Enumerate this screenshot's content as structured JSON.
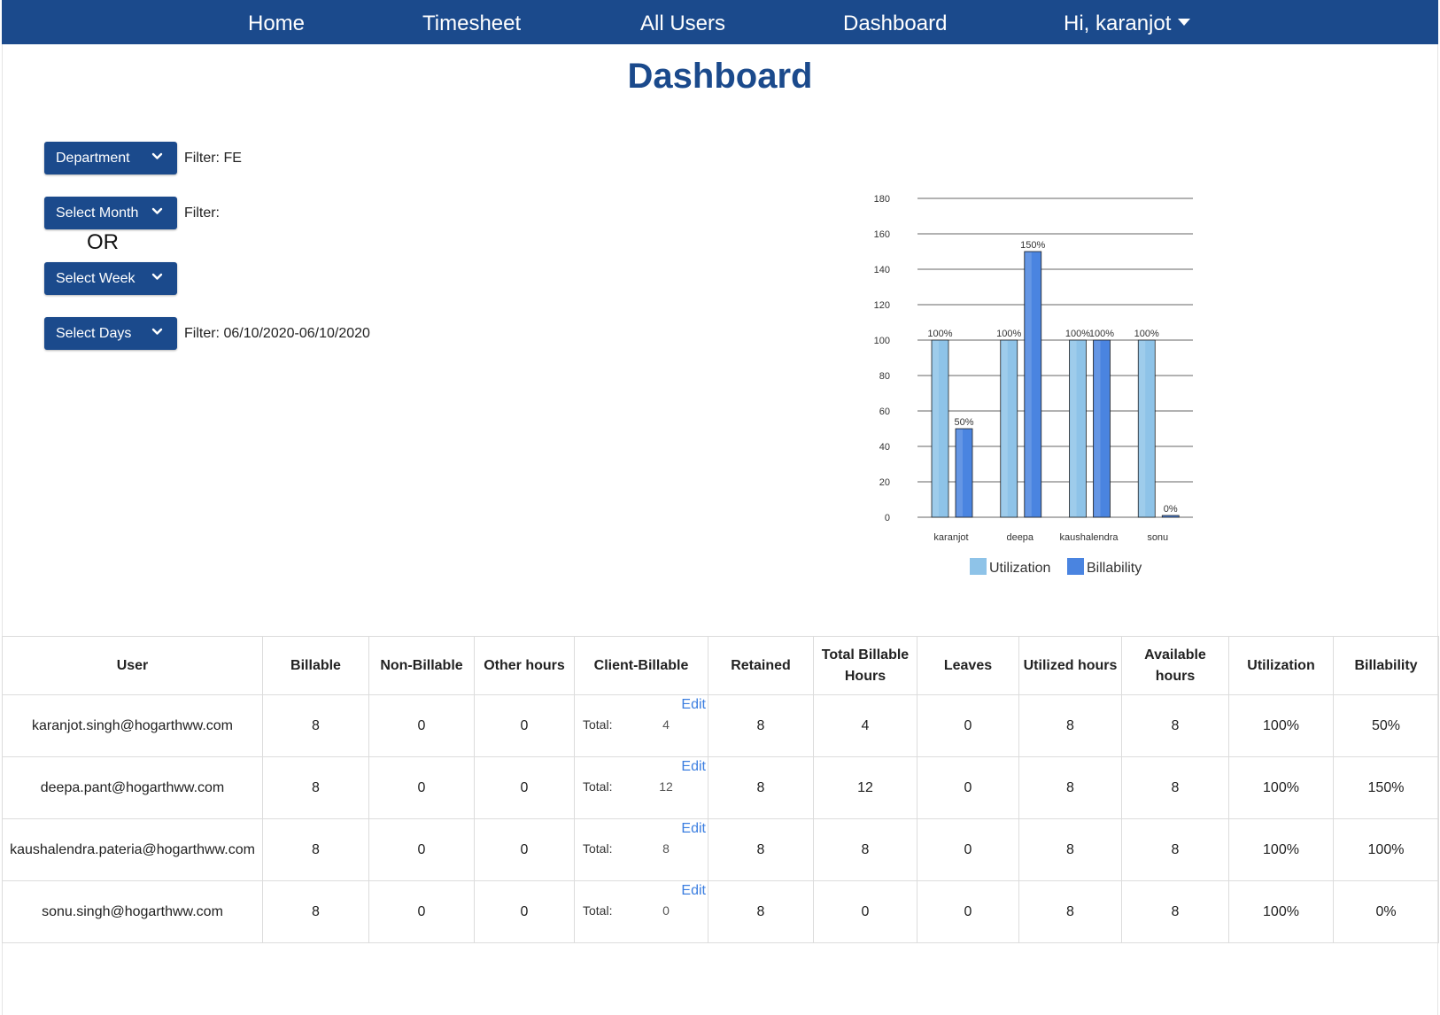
{
  "nav": {
    "home": "Home",
    "timesheet": "Timesheet",
    "all_users": "All Users",
    "dashboard": "Dashboard",
    "greeting": "Hi, karanjot"
  },
  "page": {
    "title": "Dashboard"
  },
  "filters": {
    "department_label": "Department",
    "department_filter": "Filter: FE",
    "month_label": "Select Month",
    "month_filter": "Filter:",
    "or_text": "OR",
    "week_label": "Select Week",
    "days_label": "Select Days",
    "days_filter": "Filter: 06/10/2020-06/10/2020"
  },
  "chart_data": {
    "type": "bar",
    "categories": [
      "karanjot",
      "deepa",
      "kaushalendra",
      "sonu"
    ],
    "series": [
      {
        "name": "Utilization",
        "values": [
          100,
          100,
          100,
          100
        ],
        "labels": [
          "100%",
          "100%",
          "100%",
          "100%"
        ],
        "color": "#8ec3e8"
      },
      {
        "name": "Billability",
        "values": [
          50,
          150,
          100,
          0
        ],
        "labels": [
          "50%",
          "150%",
          "100%",
          "0%"
        ],
        "color": "#4a84e0"
      }
    ],
    "ylim": [
      0,
      180
    ],
    "yticks": [
      0,
      20,
      40,
      60,
      80,
      100,
      120,
      140,
      160,
      180
    ],
    "grid": true,
    "legend": "bottom"
  },
  "table": {
    "headers": [
      "User",
      "Billable",
      "Non-Billable",
      "Other hours",
      "Client-Billable",
      "Retained",
      "Total Billable Hours",
      "Leaves",
      "Utilized hours",
      "Available hours",
      "Utilization",
      "Billability"
    ],
    "edit_label": "Edit",
    "total_label": "Total:",
    "rows": [
      {
        "user": "karanjot.singh@hogarthww.com",
        "billable": "8",
        "non_billable": "0",
        "other_hours": "0",
        "client_total": "4",
        "retained": "8",
        "total_billable": "4",
        "leaves": "0",
        "utilized": "8",
        "available": "8",
        "utilization": "100%",
        "billability": "50%"
      },
      {
        "user": "deepa.pant@hogarthww.com",
        "billable": "8",
        "non_billable": "0",
        "other_hours": "0",
        "client_total": "12",
        "retained": "8",
        "total_billable": "12",
        "leaves": "0",
        "utilized": "8",
        "available": "8",
        "utilization": "100%",
        "billability": "150%"
      },
      {
        "user": "kaushalendra.pateria@hogarthww.com",
        "billable": "8",
        "non_billable": "0",
        "other_hours": "0",
        "client_total": "8",
        "retained": "8",
        "total_billable": "8",
        "leaves": "0",
        "utilized": "8",
        "available": "8",
        "utilization": "100%",
        "billability": "100%"
      },
      {
        "user": "sonu.singh@hogarthww.com",
        "billable": "8",
        "non_billable": "0",
        "other_hours": "0",
        "client_total": "0",
        "retained": "8",
        "total_billable": "0",
        "leaves": "0",
        "utilized": "8",
        "available": "8",
        "utilization": "100%",
        "billability": "0%"
      }
    ]
  }
}
